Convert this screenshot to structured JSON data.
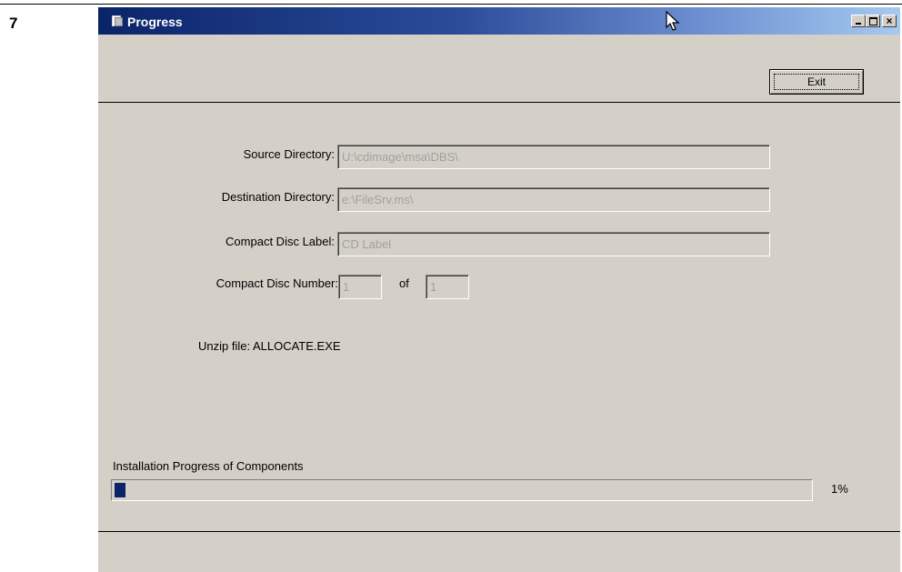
{
  "step_number": "7",
  "window": {
    "title": "Progress",
    "controls": {
      "minimize": "_",
      "maximize": "□",
      "close": "×"
    }
  },
  "toolbar": {
    "exit_label": "Exit"
  },
  "fields": {
    "source_directory": {
      "label": "Source Directory:",
      "value": "U:\\cdimage\\msa\\DBS\\"
    },
    "destination_directory": {
      "label": "Destination Directory:",
      "value": "e:\\FileSrv.ms\\"
    },
    "cd_label": {
      "label": "Compact Disc Label:",
      "value": "CD Label"
    },
    "cd_number": {
      "label": "Compact Disc Number:",
      "value": "1",
      "of_label": "of",
      "of_value": "1"
    }
  },
  "status": {
    "unzip": "Unzip file: ALLOCATE.EXE"
  },
  "progress": {
    "caption": "Installation Progress of Components",
    "percent_text": "1%",
    "fraction": 0.015
  },
  "colors": {
    "titlebar_start": "#0a246a",
    "titlebar_end": "#a6caf0",
    "window_bg": "#d4d0c8",
    "progress_fill": "#0a246a"
  },
  "icons": {
    "window_icon": "app-window-icon",
    "cursor": "mouse-pointer-icon"
  }
}
